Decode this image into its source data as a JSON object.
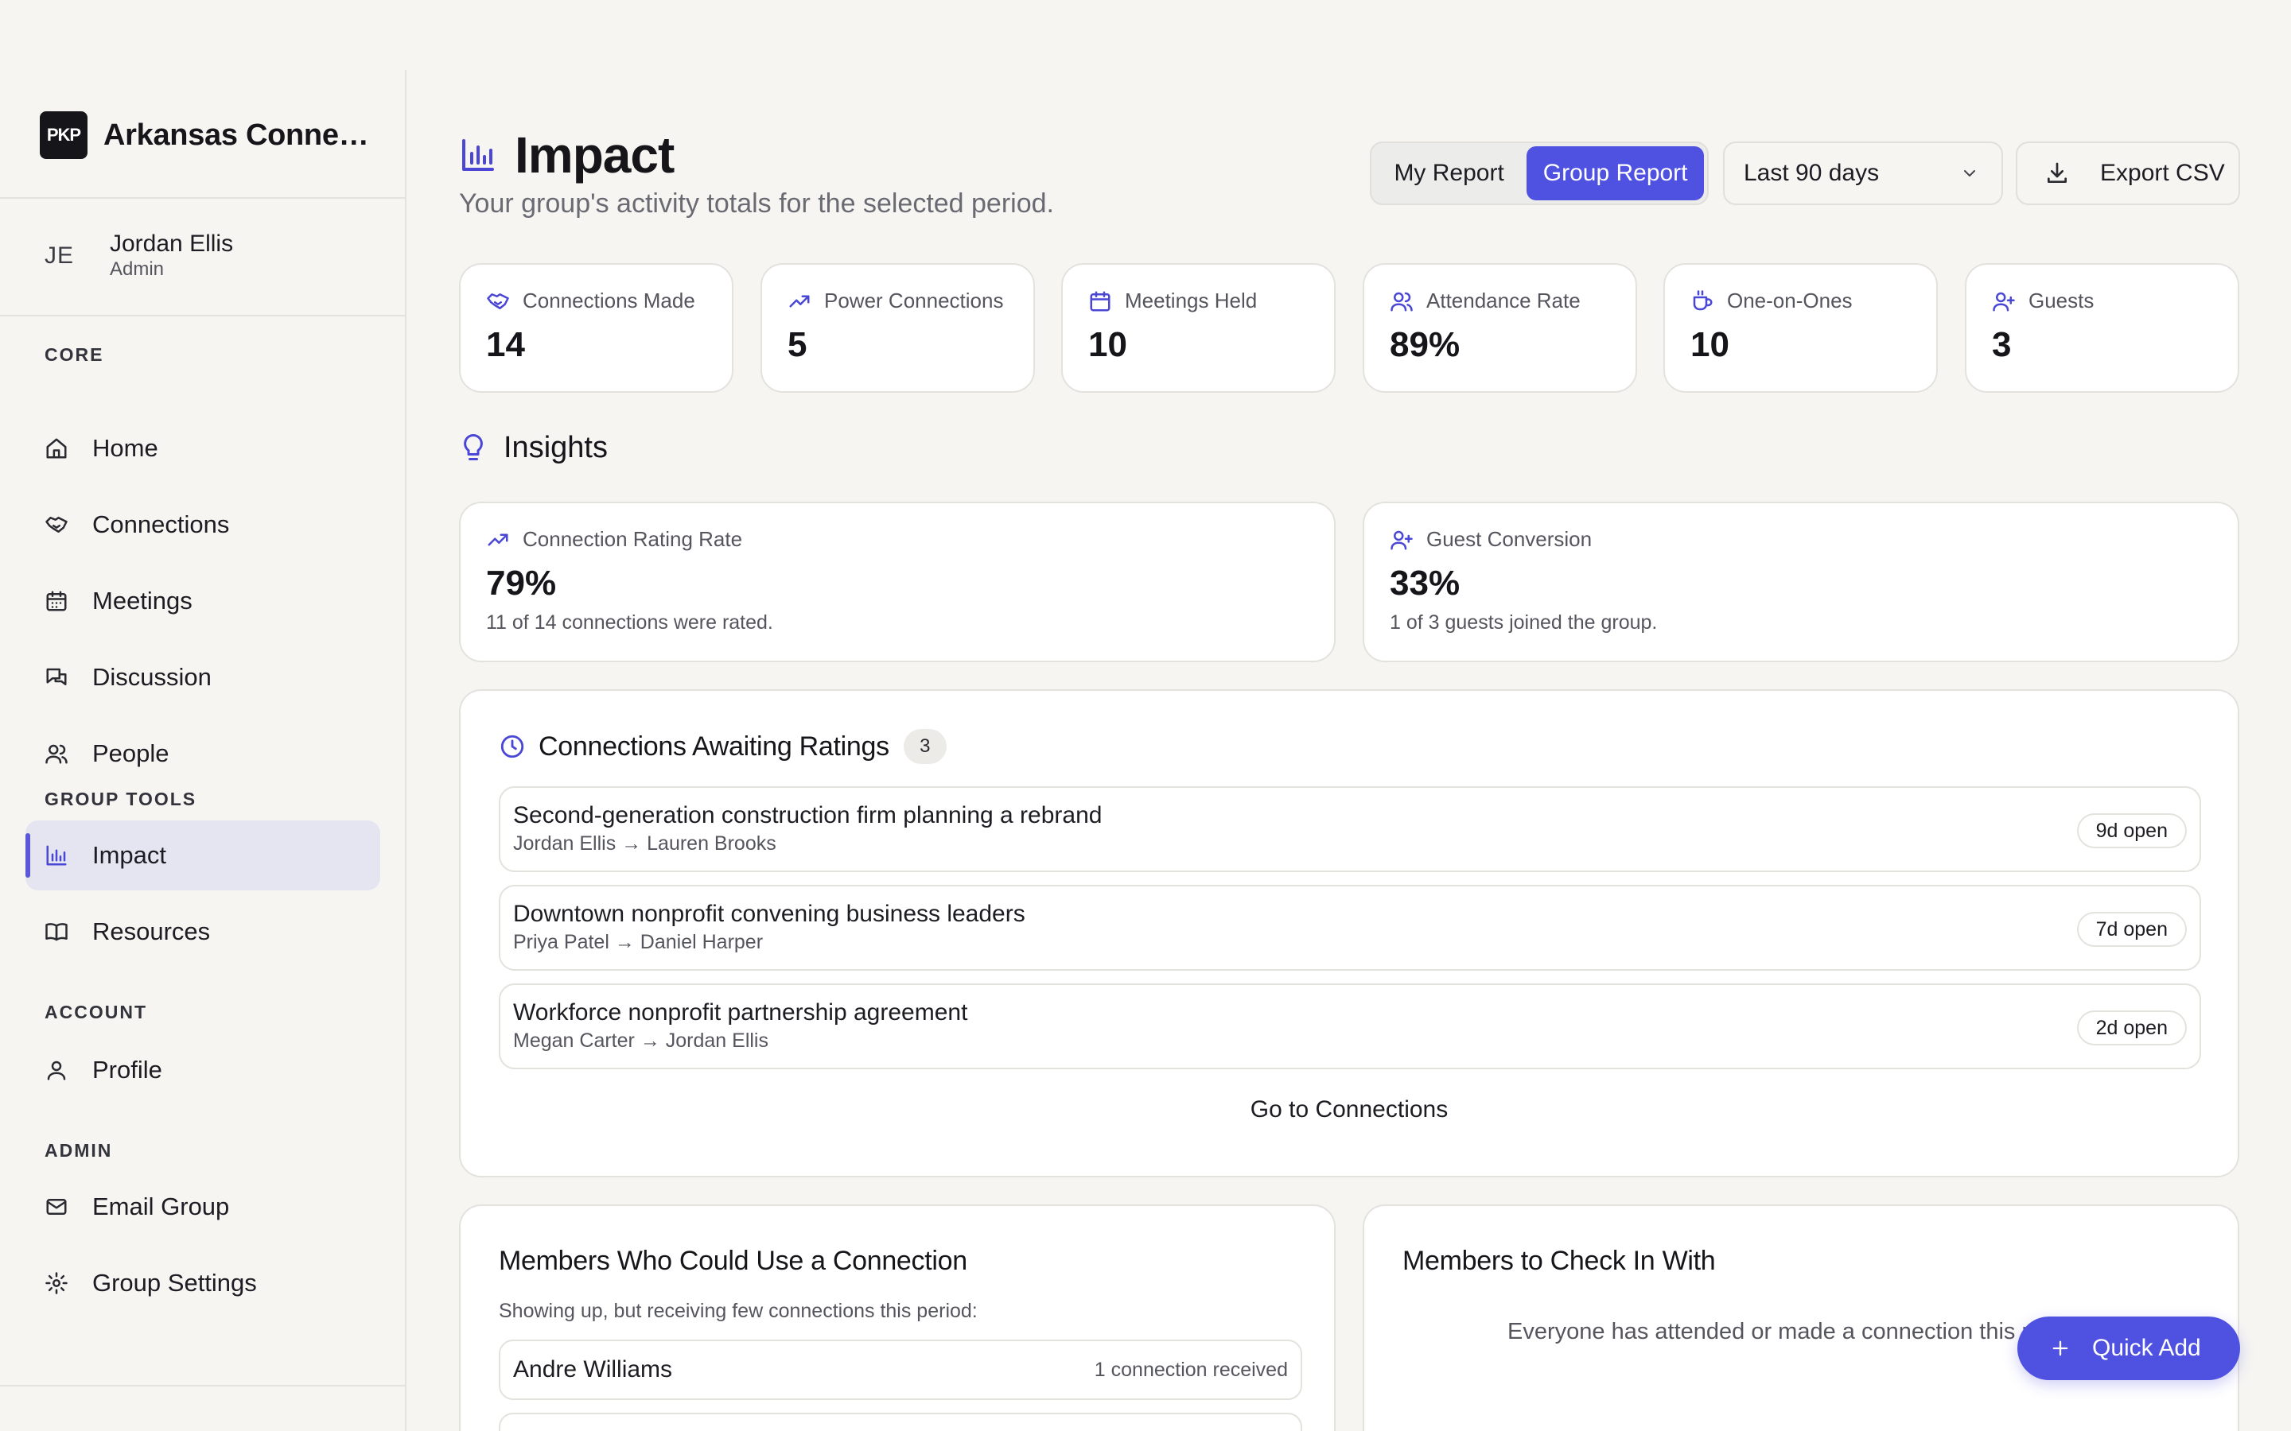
{
  "brand": {
    "logo_text": "PKP",
    "name": "Arkansas Connections Group"
  },
  "user": {
    "initials": "JE",
    "name": "Jordan Ellis",
    "role": "Admin"
  },
  "nav": {
    "sections": [
      {
        "heading": "CORE",
        "items": [
          {
            "label": "Home",
            "icon": "home-icon"
          },
          {
            "label": "Connections",
            "icon": "handshake-icon"
          },
          {
            "label": "Meetings",
            "icon": "calendar-icon"
          },
          {
            "label": "Discussion",
            "icon": "chat-icon"
          },
          {
            "label": "People",
            "icon": "users-icon"
          }
        ]
      },
      {
        "heading": "GROUP TOOLS",
        "items": [
          {
            "label": "Impact",
            "icon": "bar-chart-icon",
            "active": true
          },
          {
            "label": "Resources",
            "icon": "book-icon"
          }
        ]
      },
      {
        "heading": "ACCOUNT",
        "items": [
          {
            "label": "Profile",
            "icon": "user-icon"
          }
        ]
      },
      {
        "heading": "ADMIN",
        "items": [
          {
            "label": "Email Group",
            "icon": "mail-icon"
          },
          {
            "label": "Group Settings",
            "icon": "gear-icon"
          }
        ]
      }
    ]
  },
  "page": {
    "title": "Impact",
    "subtitle": "Your group's activity totals for the selected period."
  },
  "toolbar": {
    "report_options": [
      "My Report",
      "Group Report"
    ],
    "selected_report": "Group Report",
    "period": "Last 90 days",
    "export_label": "Export CSV"
  },
  "stats": [
    {
      "label": "Connections Made",
      "value": "14",
      "icon": "handshake-icon"
    },
    {
      "label": "Power Connections",
      "value": "5",
      "icon": "trending-up-icon"
    },
    {
      "label": "Meetings Held",
      "value": "10",
      "icon": "calendar-icon"
    },
    {
      "label": "Attendance Rate",
      "value": "89%",
      "icon": "users-icon"
    },
    {
      "label": "One-on-Ones",
      "value": "10",
      "icon": "coffee-icon"
    },
    {
      "label": "Guests",
      "value": "3",
      "icon": "user-plus-icon"
    }
  ],
  "insights": {
    "title": "Insights",
    "cards": [
      {
        "label": "Connection Rating Rate",
        "value": "79%",
        "note": "11 of 14 connections were rated.",
        "icon": "trending-up-icon"
      },
      {
        "label": "Guest Conversion",
        "value": "33%",
        "note": "1 of 3 guests joined the group.",
        "icon": "user-plus-icon"
      }
    ]
  },
  "awaiting": {
    "title": "Connections Awaiting Ratings",
    "count": "3",
    "rows": [
      {
        "title": "Second-generation construction firm planning a rebrand",
        "from": "Jordan Ellis",
        "to": "Lauren Brooks",
        "arrow": "→",
        "open": "9d open"
      },
      {
        "title": "Downtown nonprofit convening business leaders",
        "from": "Priya Patel",
        "to": "Daniel Harper",
        "arrow": "→",
        "open": "7d open"
      },
      {
        "title": "Workforce nonprofit partnership agreement",
        "from": "Megan Carter",
        "to": "Jordan Ellis",
        "arrow": "→",
        "open": "2d open"
      }
    ],
    "link_label": "Go to Connections"
  },
  "members_use": {
    "title": "Members Who Could Use a Connection",
    "note": "Showing up, but receiving few connections this period:",
    "rows": [
      {
        "name": "Andre Williams",
        "meta": "1 connection received"
      }
    ]
  },
  "members_check": {
    "title": "Members to Check In With",
    "empty": "Everyone has attended or made a connection this period."
  },
  "fab": {
    "label": "Quick Add"
  },
  "colors": {
    "accent": "#4f51e0",
    "background": "#f6f5f2",
    "card": "#ffffff",
    "border": "#e4e2dd"
  }
}
